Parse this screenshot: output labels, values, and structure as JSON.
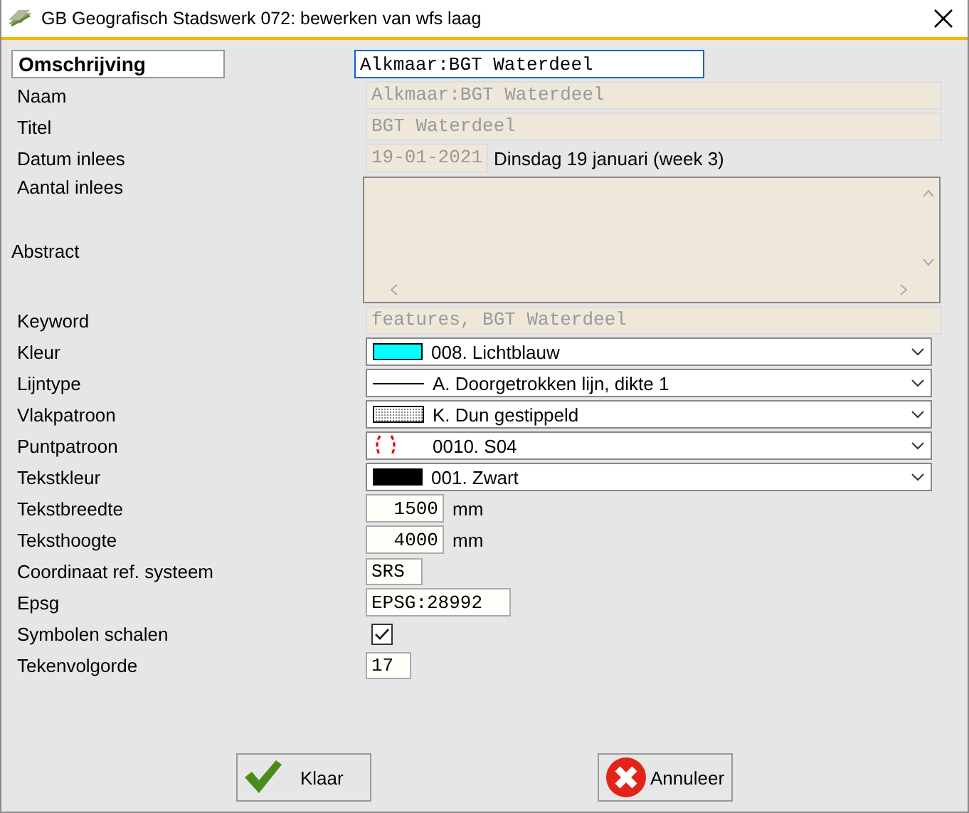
{
  "window": {
    "title": "GB Geografisch Stadswerk 072: bewerken van wfs laag"
  },
  "omschrijving": {
    "label": "Omschrijving",
    "value": "Alkmaar:BGT Waterdeel"
  },
  "rows": [
    {
      "kind": "readonly",
      "label": "Naam",
      "value": "Alkmaar:BGT Waterdeel"
    },
    {
      "kind": "readonly",
      "label": "Titel",
      "value": "BGT Waterdeel"
    },
    {
      "kind": "date",
      "label": "Datum inlees",
      "value": "19-01-2021",
      "note": "Dinsdag 19 januari (week 3)"
    },
    {
      "kind": "textarea",
      "label": "Aantal inlees",
      "label2": "Abstract"
    },
    {
      "kind": "readonly",
      "label": "Keyword",
      "value": "features, BGT Waterdeel"
    },
    {
      "kind": "dropdown",
      "swatch": {
        "kind": "color",
        "color": "#00ffff"
      },
      "label": "Kleur",
      "value": "008. Lichtblauw"
    },
    {
      "kind": "dropdown",
      "swatch": {
        "kind": "line"
      },
      "label": "Lijntype",
      "value": "A. Doorgetrokken lijn, dikte 1"
    },
    {
      "kind": "dropdown",
      "swatch": {
        "kind": "pattern"
      },
      "label": "Vlakpatroon",
      "value": "K. Dun gestippeld"
    },
    {
      "kind": "dropdown",
      "swatch": {
        "kind": "symbol"
      },
      "label": "Puntpatroon",
      "value": "0010. S04"
    },
    {
      "kind": "dropdown",
      "swatch": {
        "kind": "color",
        "color": "#000000"
      },
      "label": "Tekstkleur",
      "value": "001. Zwart"
    },
    {
      "kind": "number",
      "label": "Tekstbreedte",
      "value": "1500",
      "unit": "mm"
    },
    {
      "kind": "number",
      "label": "Teksthoogte",
      "value": "4000",
      "unit": "mm"
    },
    {
      "kind": "short",
      "label": "Coordinaat ref. systeem",
      "value": "SRS"
    },
    {
      "kind": "medium",
      "label": "Epsg",
      "value": "EPSG:28992"
    },
    {
      "kind": "checkbox",
      "label": "Symbolen schalen",
      "checked": true
    },
    {
      "kind": "short",
      "label": "Tekenvolgorde",
      "value": "17"
    }
  ],
  "buttons": [
    {
      "kind": "ok",
      "label": "Klaar"
    },
    {
      "kind": "cancel",
      "label": "Annuleer"
    }
  ]
}
